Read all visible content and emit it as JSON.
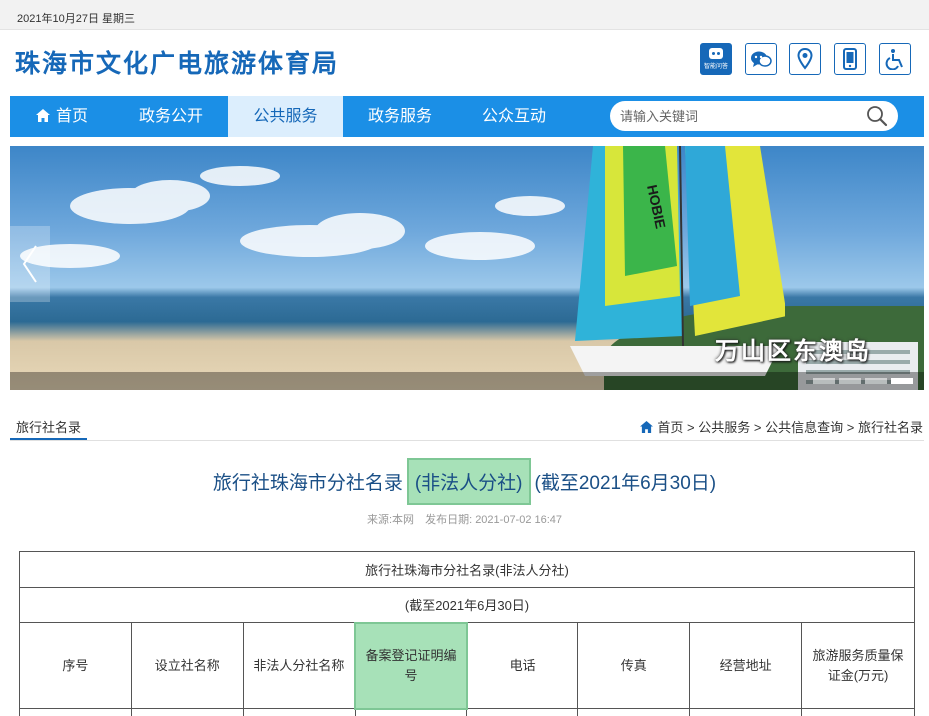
{
  "topbar": {
    "date": "2021年10月27日 星期三"
  },
  "site": {
    "title": "珠海市文化广电旅游体育局"
  },
  "top_icons": {
    "robot_label": "智能问答"
  },
  "nav": {
    "items": [
      "首页",
      "政务公开",
      "公共服务",
      "政务服务",
      "公众互动"
    ],
    "active": "公共服务"
  },
  "search": {
    "placeholder": "请输入关键词"
  },
  "banner": {
    "caption": "万山区东澳岛",
    "sail_text": "HOBIE"
  },
  "section": {
    "tab": "旅行社名录"
  },
  "breadcrumb": {
    "items": [
      "首页",
      "公共服务",
      "公共信息查询",
      "旅行社名录"
    ],
    "separator": ">"
  },
  "article": {
    "title_part1": "旅行社珠海市分社名录",
    "title_highlight": "(非法人分社)",
    "title_part2": "(截至2021年6月30日)",
    "source": "来源:本网",
    "publish_date": "发布日期: 2021-07-02 16:47"
  },
  "table": {
    "caption": "旅行社珠海市分社名录(非法人分社)",
    "subcaption": "(截至2021年6月30日)",
    "headers": [
      "序号",
      "设立社名称",
      "非法人分社名称",
      "备案登记证明编号",
      "电话",
      "传真",
      "经营地址",
      "旅游服务质量保证金(万元)"
    ]
  },
  "colors": {
    "brand": "#1668b8",
    "nav": "#1b8fe6",
    "highlight": "#a7e1b8"
  }
}
